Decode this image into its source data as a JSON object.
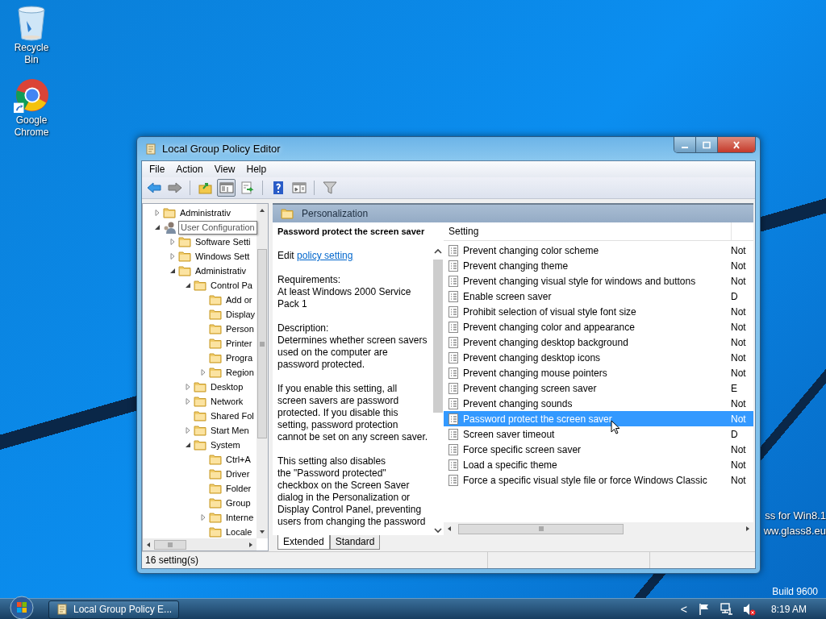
{
  "desktop": {
    "icons": [
      {
        "label": "Recycle Bin",
        "kind": "recycle"
      },
      {
        "label": "Google Chrome",
        "kind": "chrome"
      }
    ],
    "glass_lines": [
      "ss for Win8.1",
      "ww.glass8.eu"
    ],
    "build": "Build 9600"
  },
  "window": {
    "title": "Local Group Policy Editor"
  },
  "menu": [
    "File",
    "Action",
    "View",
    "Help"
  ],
  "toolbar": [
    {
      "kind": "back",
      "pressed": false
    },
    {
      "kind": "forward",
      "pressed": false
    },
    {
      "kind": "up",
      "pressed": false
    },
    {
      "kind": "tree",
      "pressed": true
    },
    {
      "kind": "export",
      "pressed": false
    },
    {
      "kind": "help",
      "pressed": false
    },
    {
      "kind": "pane",
      "pressed": false
    },
    {
      "kind": "filter",
      "pressed": false
    }
  ],
  "tree": [
    {
      "label": "Administrativ",
      "expanded": false,
      "kind": "folder"
    },
    {
      "label": "User Configuration",
      "expanded": true,
      "kind": "user",
      "tooltip": true,
      "children": [
        {
          "label": "Software Setti",
          "expanded": false,
          "kind": "folder"
        },
        {
          "label": "Windows Sett",
          "expanded": false,
          "kind": "folder"
        },
        {
          "label": "Administrativ",
          "expanded": true,
          "kind": "folder",
          "children": [
            {
              "label": "Control Pa",
              "expanded": true,
              "kind": "folder",
              "children": [
                {
                  "label": "Add or",
                  "kind": "folder"
                },
                {
                  "label": "Display",
                  "kind": "folder"
                },
                {
                  "label": "Person",
                  "kind": "folder"
                },
                {
                  "label": "Printer",
                  "kind": "folder"
                },
                {
                  "label": "Progra",
                  "kind": "folder"
                },
                {
                  "label": "Region",
                  "expanded": false,
                  "kind": "folder"
                }
              ]
            },
            {
              "label": "Desktop",
              "expanded": false,
              "kind": "folder"
            },
            {
              "label": "Network",
              "expanded": false,
              "kind": "folder"
            },
            {
              "label": "Shared Fol",
              "kind": "folder"
            },
            {
              "label": "Start Men",
              "expanded": false,
              "kind": "folder"
            },
            {
              "label": "System",
              "expanded": true,
              "kind": "folder",
              "children": [
                {
                  "label": "Ctrl+A",
                  "kind": "folder"
                },
                {
                  "label": "Driver",
                  "kind": "folder"
                },
                {
                  "label": "Folder",
                  "kind": "folder"
                },
                {
                  "label": "Group",
                  "kind": "folder"
                },
                {
                  "label": "Interne",
                  "expanded": false,
                  "kind": "folder"
                },
                {
                  "label": "Locale",
                  "kind": "folder"
                }
              ]
            }
          ]
        }
      ]
    }
  ],
  "details": {
    "folder": "Personalization",
    "title": "Password protect the screen saver",
    "edit_prefix": "Edit",
    "edit_link": "policy setting",
    "paragraphs": [
      "Requirements:\nAt least Windows 2000 Service\nPack 1",
      "Description:\nDetermines whether screen savers\nused on the computer are\npassword protected.",
      "If you enable this setting, all\nscreen savers are password\nprotected. If you disable this\nsetting, password protection\ncannot be set on any screen saver.",
      "This setting also disables\nthe \"Password protected\"\ncheckbox on the Screen Saver\ndialog in the Personalization or\nDisplay Control Panel, preventing\nusers from changing the password"
    ]
  },
  "table": {
    "columns": [
      "Setting"
    ],
    "rows": [
      {
        "setting": "Prevent changing color scheme",
        "state": "Not",
        "selected": false
      },
      {
        "setting": "Prevent changing theme",
        "state": "Not",
        "selected": false
      },
      {
        "setting": "Prevent changing visual style for windows and buttons",
        "state": "Not",
        "selected": false
      },
      {
        "setting": "Enable screen saver",
        "state": "D",
        "selected": false
      },
      {
        "setting": "Prohibit selection of visual style font size",
        "state": "Not",
        "selected": false
      },
      {
        "setting": "Prevent changing color and appearance",
        "state": "Not",
        "selected": false
      },
      {
        "setting": "Prevent changing desktop background",
        "state": "Not",
        "selected": false
      },
      {
        "setting": "Prevent changing desktop icons",
        "state": "Not",
        "selected": false
      },
      {
        "setting": "Prevent changing mouse pointers",
        "state": "Not",
        "selected": false
      },
      {
        "setting": "Prevent changing screen saver",
        "state": "E",
        "selected": false
      },
      {
        "setting": "Prevent changing sounds",
        "state": "Not",
        "selected": false
      },
      {
        "setting": "Password protect the screen saver",
        "state": "Not",
        "selected": true
      },
      {
        "setting": "Screen saver timeout",
        "state": "D",
        "selected": false
      },
      {
        "setting": "Force specific screen saver",
        "state": "Not",
        "selected": false
      },
      {
        "setting": "Load a specific theme",
        "state": "Not",
        "selected": false
      },
      {
        "setting": "Force a specific visual style file or force Windows Classic",
        "state": "Not",
        "selected": false
      }
    ]
  },
  "tabs": [
    {
      "label": "Extended",
      "selected": true
    },
    {
      "label": "Standard",
      "selected": false
    }
  ],
  "status_bar": "16 setting(s)",
  "taskbar": {
    "button": "Local Group Policy E...",
    "tray_chevron": "<",
    "time": "8:19 AM",
    "volume_muted": true
  }
}
